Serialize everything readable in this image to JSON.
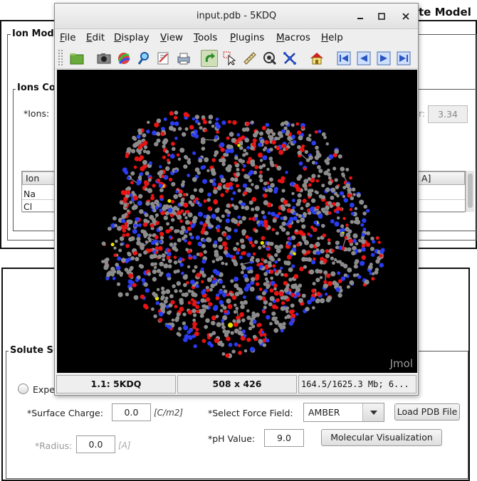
{
  "background_app": {
    "title_fragment": "te Model",
    "ion_panel": {
      "legend": "Ion Mod",
      "ions_sub_legend": "Ions Co",
      "ions_label": "*Ions:",
      "radius_label_fragment": "r:",
      "radius_value": "3.34",
      "table": {
        "col_ion": "Ion",
        "col_right_fragment": "A]",
        "rows": [
          "Na",
          "Cl"
        ]
      }
    },
    "solute_panel": {
      "legend": "Solute Su",
      "radio_label_fragment": "Expe",
      "surface_charge_label": "*Surface Charge:",
      "surface_charge_value": "0.0",
      "surface_charge_unit": "[C/m2]",
      "radius_label": "*Radius:",
      "radius_value": "0.0",
      "radius_unit": "[A]",
      "force_field_label": "*Select Force Field:",
      "force_field_value": "AMBER",
      "load_pdb_button": "Load PDB File",
      "ph_label": "*pH Value:",
      "ph_value": "9.0",
      "molvis_button": "Molecular Visualization"
    }
  },
  "jmol_window": {
    "title": "input.pdb - 5KDQ",
    "menus": [
      {
        "label": "File",
        "mnemonic": "F",
        "rest": "ile"
      },
      {
        "label": "Edit",
        "mnemonic": "E",
        "rest": "dit"
      },
      {
        "label": "Display",
        "mnemonic": "D",
        "rest": "isplay"
      },
      {
        "label": "View",
        "mnemonic": "V",
        "rest": "iew"
      },
      {
        "label": "Tools",
        "mnemonic": "T",
        "rest": "ools"
      },
      {
        "label": "Plugins",
        "mnemonic": "P",
        "rest": "lugins"
      },
      {
        "label": "Macros",
        "mnemonic": "M",
        "rest": "acros"
      },
      {
        "label": "Help",
        "mnemonic": "H",
        "rest": "elp"
      }
    ],
    "toolbar_icons": [
      "open-folder-icon",
      "camera-icon",
      "spectrum-icon",
      "pick-magnifier-icon",
      "script-editor-icon",
      "print-icon",
      "rotate-icon",
      "select-pointer-icon",
      "measure-ruler-icon",
      "spin-icon",
      "molecule-atoms-icon",
      "home-icon",
      "first-frame-icon",
      "previous-frame-icon",
      "next-frame-icon",
      "last-frame-icon"
    ],
    "viewer_logo": "Jmol",
    "status": {
      "model": "1.1: 5KDQ",
      "size": "508 x 426",
      "memory": "164.5/1625.3 Mb;   6..."
    },
    "atom_colors": {
      "carbon": "#8c8c8c",
      "oxygen": "#e61414",
      "nitrogen": "#2a3cf0",
      "sulfur": "#e6e600"
    }
  }
}
